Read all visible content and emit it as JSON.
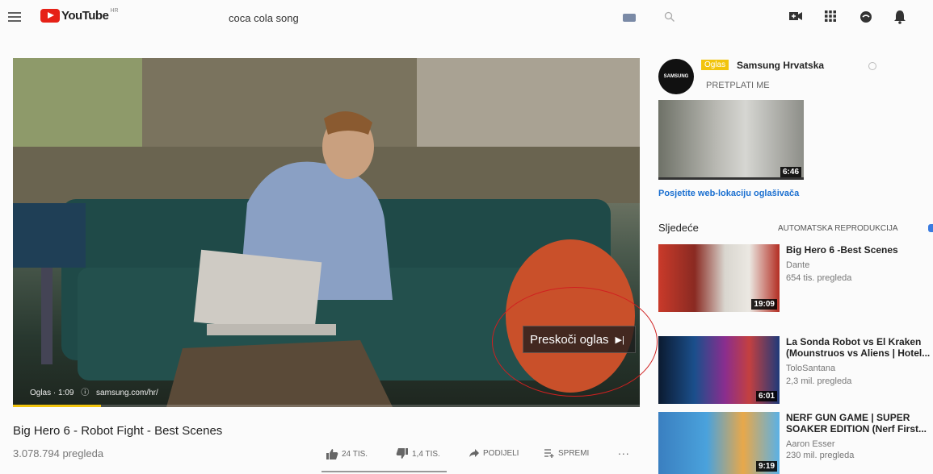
{
  "header": {
    "logo_text": "YouTube",
    "logo_country": "HR",
    "search_value": "coca cola song"
  },
  "player": {
    "ad_label": "Oglas · 1:09",
    "ad_url": "samsung.com/hr/",
    "skip_label": "Preskoči oglas",
    "skip_icon": "▶|",
    "progress": 0.14,
    "progress_color": "#f2c40d"
  },
  "video": {
    "title": "Big Hero 6 - Robot Fight - Best Scenes",
    "views": "3.078.794 pregleda",
    "likes": "24 TIS.",
    "dislikes": "1,4 TIS.",
    "share_label": "PODIJELI",
    "save_label": "SPREMI",
    "more_label": "..."
  },
  "sidebar": {
    "ad": {
      "avatar_text": "SAMSUNG",
      "badge": "Oglas",
      "channel": "Samsung Hrvatska",
      "subscribe": "PRETPLATI ME",
      "duration": "6:46",
      "link": "Posjetite web-lokaciju oglašivača"
    },
    "up_next_label": "Sljedeće",
    "autoplay_label": "AUTOMATSKA REPRODUKCIJA",
    "videos": [
      {
        "title": "Big Hero 6 -Best Scenes",
        "channel": "Dante",
        "views": "654 tis. pregleda",
        "duration": "19:09"
      },
      {
        "title": "La Sonda Robot vs El Kraken (Mounstruos vs Aliens | Hotel...",
        "channel": "ToloSantana",
        "views": "2,3 mil. pregleda",
        "duration": "6:01"
      },
      {
        "title": "NERF GUN GAME | SUPER SOAKER EDITION (Nerf First...",
        "channel": "Aaron Esser",
        "views": "230 mil. pregleda",
        "duration": "9:19"
      }
    ]
  },
  "colors": {
    "accent_red": "#e62117",
    "ad_yellow": "#f2c40d",
    "link_blue": "#1a6fd0",
    "annotation_red": "#d02020"
  }
}
